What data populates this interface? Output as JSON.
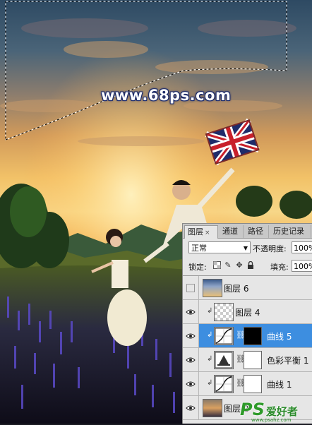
{
  "watermark": "www.68ps.com",
  "panel": {
    "tabs": [
      {
        "label": "图层",
        "close": "×",
        "active": true
      },
      {
        "label": "通道",
        "active": false
      },
      {
        "label": "路径",
        "active": false
      },
      {
        "label": "历史记录",
        "active": false
      }
    ],
    "blend_mode": "正常",
    "opacity_label": "不透明度:",
    "opacity_value": "100%",
    "lock_label": "锁定:",
    "fill_label": "填充:",
    "fill_value": "100%",
    "layers": [
      {
        "name": "图层 6",
        "visible": false,
        "thumb": "photo",
        "selected": false
      },
      {
        "name": "图层 4",
        "visible": true,
        "clipped": true,
        "thumb": "transparent",
        "selected": false
      },
      {
        "name": "曲线 5",
        "visible": true,
        "clipped": true,
        "thumb": "curves",
        "mask": "black",
        "selected": true
      },
      {
        "name": "色彩平衡 1",
        "visible": true,
        "clipped": true,
        "thumb": "color-balance",
        "mask": "white",
        "selected": false
      },
      {
        "name": "曲线 1",
        "visible": true,
        "clipped": true,
        "thumb": "curves",
        "mask": "white",
        "selected": false
      },
      {
        "name": "图层 2",
        "visible": true,
        "thumb": "photo",
        "selected": false
      }
    ]
  },
  "brand": {
    "ps": "PS",
    "text": "爱好者",
    "url": "www.psahz.com"
  },
  "icons": [
    "eye-icon",
    "lock-transparent-icon",
    "lock-brush-icon",
    "lock-move-icon",
    "lock-all-icon",
    "chain-link-icon",
    "dropdown-arrow-icon"
  ]
}
